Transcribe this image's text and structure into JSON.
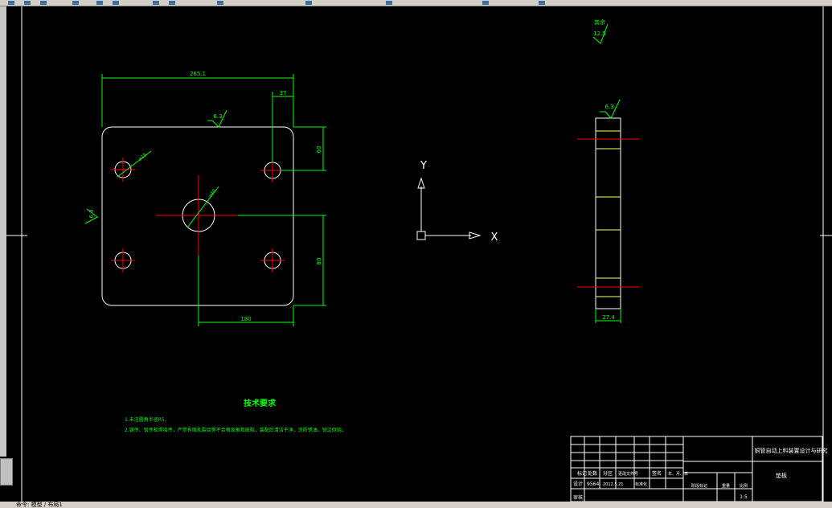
{
  "colors": {
    "background": "#000000",
    "dimension": "#00ff00",
    "outline": "#ffffff",
    "centerline": "#ff0000",
    "hidden_line": "#ffff66",
    "frame": "#ffffff"
  },
  "front_view": {
    "dim_overall_width": "265.1",
    "dim_top_offset": "37",
    "dim_hole_spacing_vert_top": "60",
    "dim_hole_spacing_vert_bottom": "80",
    "dim_bottom_width": "180",
    "surface_roughness_top": "6.3",
    "surface_roughness_left": "6.3",
    "hole_small_diameter": "⌀15",
    "hole_center_diameter": "⌀40"
  },
  "side_view": {
    "roughness_top": "6.3",
    "dim_thickness": "27.4"
  },
  "general_roughness": {
    "label": "其余",
    "value": "12.5"
  },
  "ucs_icon": {
    "x_label": "X",
    "y_label": "Y"
  },
  "technical_requirements": {
    "title": "技术要求",
    "items": [
      "1.未注圆角半径R5.",
      "2.铸件、锻件和焊接件，严禁有缩孔裂纹等不合格现象和缺陷，装配后清洁干净，涂防锈油，锐边倒钝。"
    ]
  },
  "title_block": {
    "drawing_title": "铜管自动上料装置设计与研究",
    "part_name": "垫板",
    "scale": "1:5",
    "headers": [
      "标记",
      "处数",
      "分区",
      "更改文件号",
      "签名",
      "年、月、日"
    ],
    "designer_row": [
      "设计",
      "9564",
      "2012.5.21",
      "标准化"
    ],
    "stage_labels": [
      "阶段标记",
      "重量",
      "比例"
    ],
    "review_label": "审核"
  },
  "statusbar": {
    "text": "命令: 模型 / 布局1"
  }
}
